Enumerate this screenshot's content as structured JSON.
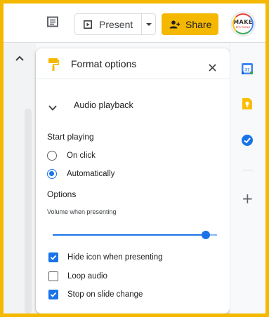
{
  "topbar": {
    "present_label": "Present",
    "share_label": "Share",
    "avatar_text": "MAKE",
    "avatar_sub": "ERYTHING"
  },
  "panel": {
    "title": "Format options",
    "section_title": "Audio playback",
    "start_playing_label": "Start playing",
    "radio_options": [
      {
        "label": "On click",
        "selected": false
      },
      {
        "label": "Automatically",
        "selected": true
      }
    ],
    "options_label": "Options",
    "volume_label": "Volume when presenting",
    "volume_level": 0.9,
    "checkboxes": [
      {
        "label": "Hide icon when presenting",
        "checked": true
      },
      {
        "label": "Loop audio",
        "checked": false
      },
      {
        "label": "Stop on slide change",
        "checked": true
      }
    ]
  },
  "icons": {
    "comments": "comment-icon",
    "present": "present-slide-icon",
    "present_caret": "caret-down-icon",
    "share": "person-add-icon",
    "format": "paint-roller-icon",
    "close": "close-icon",
    "collapse": "chevron-up-icon",
    "section": "chevron-down-icon",
    "calendar": "calendar-icon",
    "keep": "keep-icon",
    "tasks": "tasks-icon",
    "add": "plus-icon"
  },
  "colors": {
    "accent": "#1a73e8",
    "share_bg": "#f5b800",
    "frame_border": "#f5b800"
  }
}
